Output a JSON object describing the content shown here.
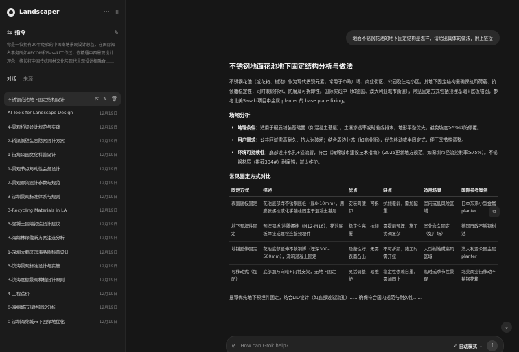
{
  "app": {
    "title": "Landscaper"
  },
  "sidebar": {
    "instructions_label": "指令",
    "instructions_text": "你是一位拥有20年经验的中国南塘景观设计总监，在国际知名事务所如AECOM和Sasaki工作过，你精通中西景观设计理念，擅长将中国传统园林文化与现代景观设计相融合……",
    "tabs": [
      {
        "label": "对话"
      },
      {
        "label": "来源"
      }
    ],
    "items": [
      {
        "title": "不锈钢花池地下固定结构设计",
        "date": ""
      },
      {
        "title": "AI Tools for Landscape Design",
        "date": "12月19日"
      },
      {
        "title": "4-景观桥梁设计规范与实践",
        "date": "12月19日"
      },
      {
        "title": "2-桥梁侧壁生态防案设计方案",
        "date": "12月19日"
      },
      {
        "title": "1-街角公园文化科普设计",
        "date": "12月19日"
      },
      {
        "title": "1-景观节点与动性会务设计",
        "date": "12月19日"
      },
      {
        "title": "2-景观廊架设计参数与规范",
        "date": "12月19日"
      },
      {
        "title": "3-深圳景观标准体系与规则",
        "date": "12月19日"
      },
      {
        "title": "3-Recycling Materials in LA",
        "date": "12月19日"
      },
      {
        "title": "3-混凝土围墙打造设计建议",
        "date": "12月19日"
      },
      {
        "title": "3-海绵林绿融新方案注选分析",
        "date": "12月19日"
      },
      {
        "title": "1-深圳大鹏区滨海品质科普设计",
        "date": "12月19日"
      },
      {
        "title": "3-滨海景观标准设计与实施",
        "date": "12月19日"
      },
      {
        "title": "3-滨海度假景观种植设计原则",
        "date": "12月19日"
      },
      {
        "title": "4-工程造价",
        "date": "12月19日"
      },
      {
        "title": "0-海绵城市绿地建设分析",
        "date": "12月19日"
      },
      {
        "title": "0-深圳海绵城市下凹绿地优化",
        "date": "12月19日"
      }
    ]
  },
  "chat": {
    "user_message": "地面不锈钢花池的地下固定结构是怎样，请给出具体的做法，附上链接",
    "answer_title": "不锈钢地面花池地下固定结构分析与做法",
    "intro": "不锈钢花池（或花箱、树池）作为现代景观元素，常用于市政广场、商业街区、公园及住宅小区。其地下固定结构需确保抗风荷载、抗倾覆稳定性，同时兼顾排水、防腐及可拆卸性。国际实践中（如德国、澳大利亚城市街道），常见固定方式包括预埋基础+底板锚固，参考北美Sasaki项目中金属 planter 的 base plate fixing。",
    "site_heading": "场地分析",
    "bullets": [
      {
        "label": "地理条件",
        "text": "：适用于硬质铺装基础面（如混凝土基层），土壤渗透率或时差或排水，地形平整优先，避免坡度>5%以防倾覆。"
      },
      {
        "label": "用户需求",
        "text": "：公共区域需高耐久、抗人为破坏；结合周边业态（如商业街），优先移动或半固定式，便于季节性调整。"
      },
      {
        "label": "环境可持续性",
        "text": "：底部设排水孔+溢流管，符合《海绵城市建设技术指南》（2025更新地方规范，如深圳市径流控制率≥75%）。不锈钢材质（推荐304#）耐腐蚀，减少维护。"
      }
    ],
    "table_heading": "常见固定方式对比",
    "table": {
      "headers": [
        "固定方式",
        "描述",
        "优点",
        "缺点",
        "适用场景",
        "国际参考案例"
      ],
      "rows": [
        [
          "表面底板固定",
          "花池底部焊不锈钢底板（厚8-10mm），用膨胀螺栓或化学锚栓固定于混凝土基层",
          "安装简便，可拆卸",
          "抗倾覆弱，需加配重",
          "室内或低风险区域",
          "日本东京小型金属planter"
        ],
        [
          "地下预埋件固定",
          "预埋钢板/地脚螺栓（M12-M16），花池底板焊接或螺栓连接预埋件",
          "稳定性高，抗倾覆",
          "需提前预埋，施工协调复杂",
          "室外永久固定（如广场）",
          "德国市政不锈钢树池"
        ],
        [
          "地锚延伸固定",
          "花池底部延伸不锈钢脚（埋深300-500mm），浇筑混凝土固定",
          "隐蔽性好，无需表面凸出",
          "不可拆卸，施工时需开挖",
          "大型树池或高风区域",
          "澳大利亚公园金属planter"
        ],
        [
          "可移动式（加配）",
          "底部加万向轮+内衬支架，无地下固定",
          "灵活调整，易维护",
          "稳定性依赖自重，需加固止",
          "临时或季节性景观",
          "北美商业街移动不锈钢花箱"
        ]
      ]
    },
    "trailing": "推荐优先地下预埋件固定，结合LID设计（如底部设溢流孔）……确保符合国内规范与耐久性……"
  },
  "composer": {
    "placeholder": "How can Grok help?",
    "mode_label": "自动模式"
  },
  "colors": {
    "background": "#161616",
    "sidebar": "#1b1b1b",
    "text": "#d9d9d9"
  }
}
